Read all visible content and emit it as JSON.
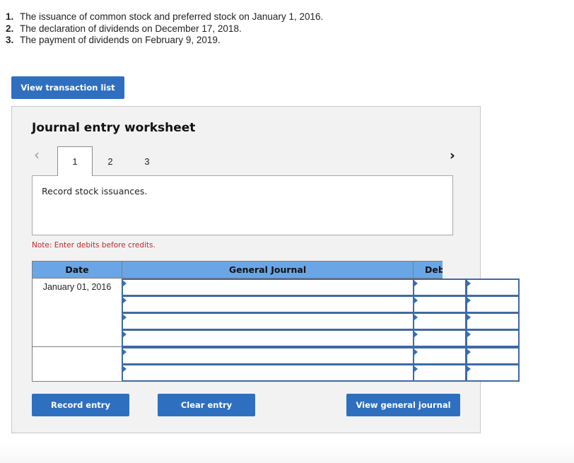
{
  "instructions": [
    {
      "num": "1.",
      "text": "The issuance of common stock and preferred stock on January 1, 2016."
    },
    {
      "num": "2.",
      "text": "The declaration of dividends on December 17, 2018."
    },
    {
      "num": "3.",
      "text": "The payment of dividends on February 9, 2019."
    }
  ],
  "buttons": {
    "view_transaction_list": "View transaction list",
    "record_entry": "Record entry",
    "clear_entry": "Clear entry",
    "view_general_journal": "View general journal"
  },
  "worksheet": {
    "title": "Journal entry worksheet",
    "nav": {
      "prev_icon": "‹",
      "next_icon": "›"
    },
    "tabs": [
      {
        "label": "1",
        "active": true
      },
      {
        "label": "2",
        "active": false
      },
      {
        "label": "3",
        "active": false
      }
    ],
    "instruction_text": "Record stock issuances.",
    "note": "Note: Enter debits before credits.",
    "table": {
      "headers": {
        "date": "Date",
        "general_journal": "General Journal",
        "debit": "Debit"
      },
      "rows": [
        {
          "date": "January 01, 2016",
          "account": "",
          "debit": "",
          "credit": ""
        },
        {
          "date": "",
          "account": "",
          "debit": "",
          "credit": ""
        },
        {
          "date": "",
          "account": "",
          "debit": "",
          "credit": ""
        },
        {
          "date": "",
          "account": "",
          "debit": "",
          "credit": ""
        },
        {
          "date": "",
          "account": "",
          "debit": "",
          "credit": ""
        },
        {
          "date": "",
          "account": "",
          "debit": "",
          "credit": ""
        }
      ]
    }
  },
  "colors": {
    "button_blue": "#2f6fbf",
    "header_blue": "#6aa6e6",
    "note_red": "#c0282b",
    "input_border": "#3f6aa3"
  }
}
